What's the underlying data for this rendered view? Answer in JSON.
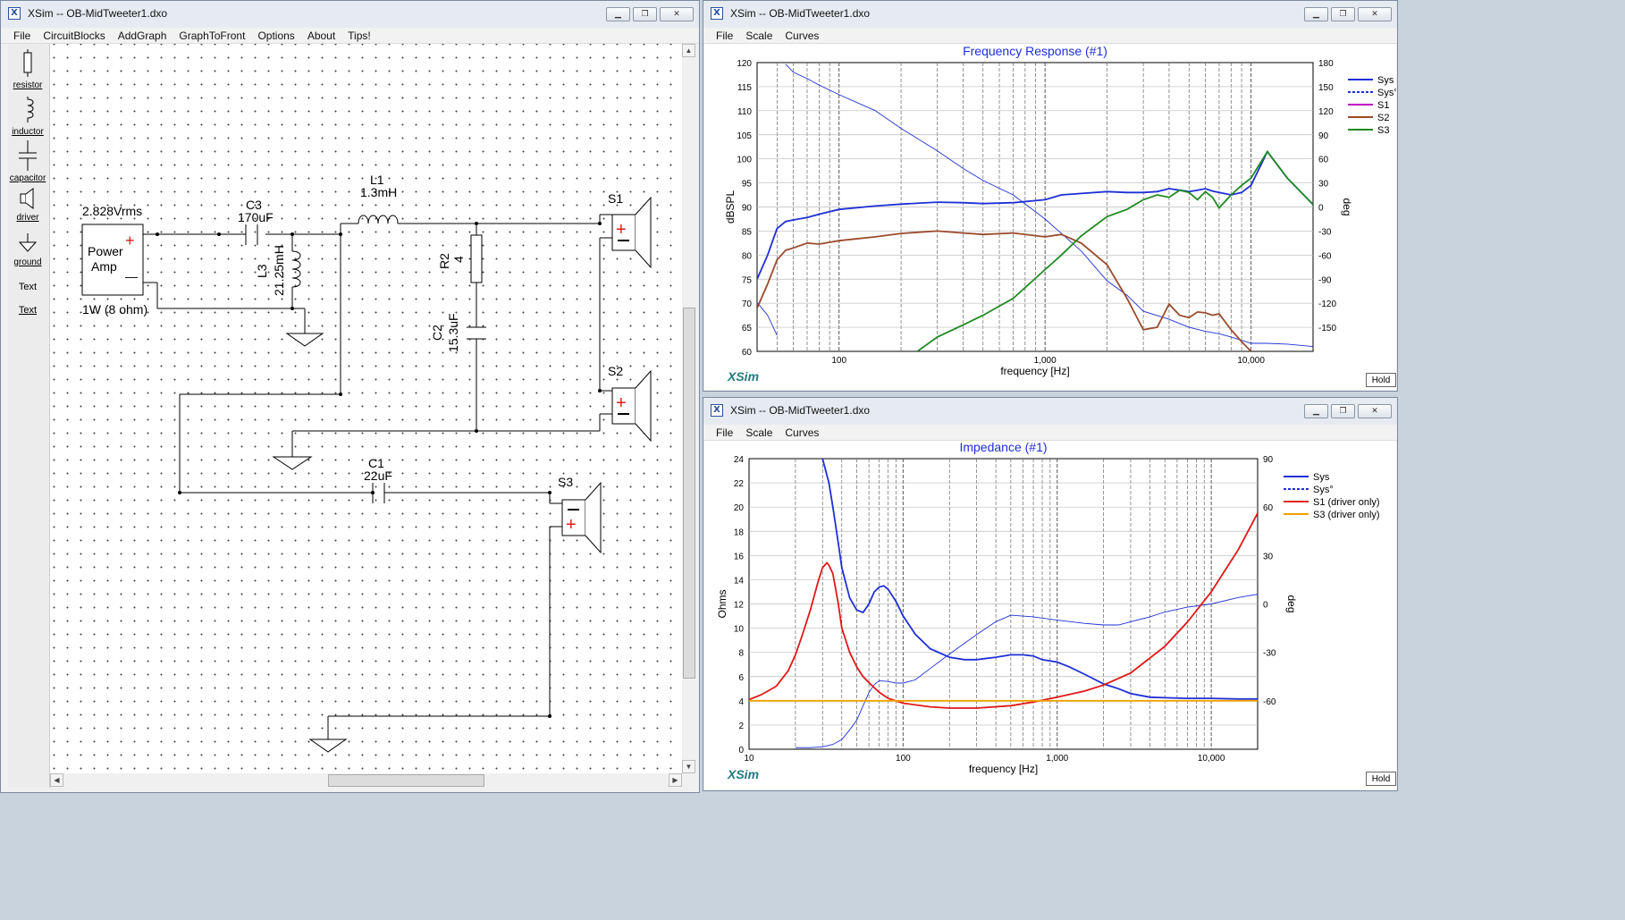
{
  "circuit_window": {
    "title": "XSim -- OB-MidTweeter1.dxo",
    "menu": [
      "File",
      "CircuitBlocks",
      "AddGraph",
      "GraphToFront",
      "Options",
      "About",
      "Tips!"
    ],
    "toolbox": [
      "resistor",
      "inductor",
      "capacitor",
      "driver",
      "ground",
      "Text",
      "Text"
    ],
    "source": {
      "voltage": "2.828Vrms",
      "name1": "Power",
      "name2": "Amp",
      "plus": "+",
      "minus": "—",
      "power": "1W (8 ohm)"
    },
    "components": {
      "c3_name": "C3",
      "c3_value": "170uF",
      "l3_name": "L3",
      "l3_value": "21.25mH",
      "l1_name": "L1",
      "l1_value": "1.3mH",
      "r2_name": "R2",
      "r2_value": "4",
      "c2_name": "C2",
      "c2_value": "15.3uF",
      "c1_name": "C1",
      "c1_value": "22uF",
      "s1": "S1",
      "s2": "S2",
      "s3": "S3"
    }
  },
  "fr_window": {
    "title": "XSim -- OB-MidTweeter1.dxo",
    "menu": [
      "File",
      "Scale",
      "Curves"
    ],
    "hold": "Hold",
    "brand": "XSim",
    "chart_data": {
      "type": "line",
      "title": "Frequency Response (#1)",
      "xlabel": "frequency [Hz]",
      "ylabel": "dBSPL",
      "y2label": "deg",
      "x_scale": "log",
      "xlim": [
        40,
        20000
      ],
      "ylim": [
        60,
        120
      ],
      "y2lim": [
        -180,
        180
      ],
      "x_ticks": [
        "100",
        "1,000",
        "10,000"
      ],
      "y_ticks": [
        "60",
        "65",
        "70",
        "75",
        "80",
        "85",
        "90",
        "95",
        "100",
        "105",
        "110",
        "115",
        "120"
      ],
      "y2_ticks": [
        "-150",
        "-120",
        "-90",
        "-60",
        "-30",
        "0",
        "30",
        "60",
        "90",
        "120",
        "150",
        "180"
      ],
      "grid": true,
      "legend_position": "right",
      "series": [
        {
          "name": "Sys",
          "color": "#1f2fd6",
          "axis": "left",
          "style": "solid",
          "x": [
            40,
            45,
            50,
            55,
            60,
            70,
            80,
            100,
            150,
            200,
            300,
            400,
            500,
            700,
            1000,
            1200,
            1500,
            2000,
            2500,
            3000,
            3500,
            4000,
            4500,
            5000,
            5500,
            6000,
            6500,
            7000,
            8000,
            9000,
            10000,
            12000,
            15000,
            20000
          ],
          "y": [
            75,
            80,
            85.5,
            87,
            87.3,
            87.8,
            88.5,
            89.5,
            90.2,
            90.6,
            91,
            90.9,
            90.7,
            90.9,
            91.5,
            92.5,
            92.8,
            93.2,
            93,
            93,
            93.2,
            93.8,
            93.5,
            93.2,
            93.5,
            93.8,
            93.3,
            93,
            92.5,
            93,
            94.5,
            101.5,
            96,
            90.5
          ]
        },
        {
          "name": "Sys°",
          "color": "#1f2fd6",
          "axis": "right",
          "style": "dashed",
          "x": [
            40,
            45,
            50,
            55,
            60,
            70,
            80,
            100,
            150,
            200,
            300,
            400,
            500,
            700,
            1000,
            1200,
            1500,
            2000,
            2500,
            3000,
            4000,
            5000,
            6000,
            7000,
            8000,
            10000,
            12000,
            15000,
            20000
          ],
          "y": [
            -119,
            -135,
            -160,
            178,
            168,
            160,
            152,
            140,
            120,
            98,
            70,
            48,
            33,
            15,
            -15,
            -33,
            -55,
            -92,
            -110,
            -130,
            -140,
            -150,
            -155,
            -158,
            -162,
            -170,
            -170,
            -171,
            -174
          ]
        },
        {
          "name": "S1",
          "color": "#c000c0",
          "axis": "left",
          "style": "solid",
          "x": [],
          "y": []
        },
        {
          "name": "S2",
          "color": "#9a4a2c",
          "axis": "left",
          "style": "solid",
          "x": [
            40,
            45,
            50,
            55,
            60,
            70,
            80,
            100,
            150,
            200,
            300,
            400,
            500,
            700,
            1000,
            1200,
            1500,
            2000,
            2500,
            3000,
            3500,
            4000,
            4500,
            5000,
            5500,
            6000,
            6500,
            7000,
            8000,
            9000,
            10000
          ],
          "y": [
            69,
            74,
            79,
            81,
            81.5,
            82.5,
            82.3,
            83,
            83.8,
            84.5,
            85,
            84.6,
            84.3,
            84.6,
            83.8,
            84.3,
            82.5,
            78,
            71,
            64.5,
            65,
            69.8,
            67.5,
            67,
            68.2,
            68,
            67.5,
            67.8,
            64.5,
            62,
            60
          ]
        },
        {
          "name": "S3",
          "color": "#1f8a22",
          "axis": "left",
          "style": "solid",
          "x": [
            240,
            300,
            400,
            500,
            700,
            1000,
            1200,
            1500,
            2000,
            2500,
            3000,
            3500,
            4000,
            4500,
            5000,
            5500,
            6000,
            6500,
            7000,
            8000,
            9000,
            10000,
            12000,
            15000,
            20000
          ],
          "y": [
            60,
            63,
            65.5,
            67.5,
            71,
            77,
            80,
            84,
            88,
            89.5,
            91.5,
            92.5,
            92,
            93.5,
            93,
            91.5,
            93.2,
            92,
            89.8,
            92.5,
            94.5,
            96,
            101.5,
            96,
            90.5
          ]
        }
      ]
    }
  },
  "imp_window": {
    "title": "XSim -- OB-MidTweeter1.dxo",
    "menu": [
      "File",
      "Scale",
      "Curves"
    ],
    "hold": "Hold",
    "brand": "XSim",
    "chart_data": {
      "type": "line",
      "title": "Impedance (#1)",
      "xlabel": "frequency [Hz]",
      "ylabel": "Ohms",
      "y2label": "deg",
      "x_scale": "log",
      "xlim": [
        10,
        20000
      ],
      "ylim": [
        0,
        24
      ],
      "y2lim": [
        -90,
        90
      ],
      "x_ticks": [
        "10",
        "100",
        "1,000",
        "10,000"
      ],
      "y_ticks": [
        "0",
        "2",
        "4",
        "6",
        "8",
        "10",
        "12",
        "14",
        "16",
        "18",
        "20",
        "22",
        "24"
      ],
      "y2_ticks": [
        "-60",
        "-30",
        "0",
        "30",
        "60",
        "90"
      ],
      "grid": true,
      "legend_position": "right",
      "series": [
        {
          "name": "Sys",
          "color": "#1f2fd6",
          "axis": "left",
          "style": "solid",
          "x": [
            30,
            33,
            35,
            38,
            40,
            45,
            50,
            55,
            60,
            65,
            70,
            75,
            80,
            90,
            100,
            120,
            150,
            200,
            250,
            300,
            400,
            500,
            600,
            700,
            800,
            1000,
            1200,
            1500,
            2000,
            2500,
            3000,
            4000,
            5000,
            7000,
            10000,
            15000,
            20000
          ],
          "y": [
            24,
            22,
            20,
            17,
            15,
            12.5,
            11.5,
            11.3,
            12,
            13,
            13.4,
            13.5,
            13.2,
            12.2,
            11,
            9.5,
            8.3,
            7.6,
            7.4,
            7.4,
            7.6,
            7.8,
            7.8,
            7.7,
            7.4,
            7.2,
            6.8,
            6.2,
            5.4,
            5,
            4.6,
            4.3,
            4.25,
            4.2,
            4.2,
            4.15,
            4.15
          ]
        },
        {
          "name": "Sys°",
          "color": "#1f2fd6",
          "axis": "right",
          "style": "dashed",
          "x": [
            20,
            25,
            30,
            35,
            40,
            45,
            50,
            55,
            60,
            65,
            70,
            80,
            90,
            100,
            120,
            150,
            200,
            300,
            400,
            500,
            700,
            1000,
            1500,
            2000,
            2500,
            3000,
            4000,
            5000,
            7000,
            10000,
            15000,
            20000
          ],
          "y": [
            -89,
            -89,
            -88.5,
            -87,
            -84,
            -78,
            -72,
            -63,
            -55,
            -50,
            -47.5,
            -48,
            -49,
            -49,
            -47,
            -40,
            -31,
            -19,
            -11,
            -7,
            -8,
            -10,
            -12,
            -13,
            -13,
            -11,
            -8,
            -5,
            -2,
            0,
            4,
            6
          ]
        },
        {
          "name": "S1 (driver only)",
          "color": "#e01818",
          "axis": "left",
          "style": "solid",
          "x": [
            10,
            12,
            15,
            18,
            20,
            22,
            25,
            28,
            30,
            32,
            33,
            35,
            38,
            40,
            45,
            50,
            55,
            60,
            70,
            80,
            100,
            150,
            200,
            300,
            500,
            700,
            1000,
            1500,
            2000,
            3000,
            5000,
            7000,
            10000,
            15000,
            20000
          ],
          "y": [
            4.1,
            4.5,
            5.2,
            6.5,
            7.8,
            9.3,
            11.5,
            13.8,
            15,
            15.4,
            15.2,
            14.5,
            12,
            10,
            8,
            6.8,
            6,
            5.5,
            4.7,
            4.2,
            3.8,
            3.5,
            3.4,
            3.4,
            3.6,
            3.9,
            4.3,
            4.8,
            5.3,
            6.3,
            8.5,
            10.5,
            13,
            16.5,
            19.5
          ]
        },
        {
          "name": "S3 (driver only)",
          "color": "#f0a000",
          "axis": "left",
          "style": "solid",
          "x": [
            10,
            20000
          ],
          "y": [
            4,
            4
          ]
        }
      ]
    }
  }
}
